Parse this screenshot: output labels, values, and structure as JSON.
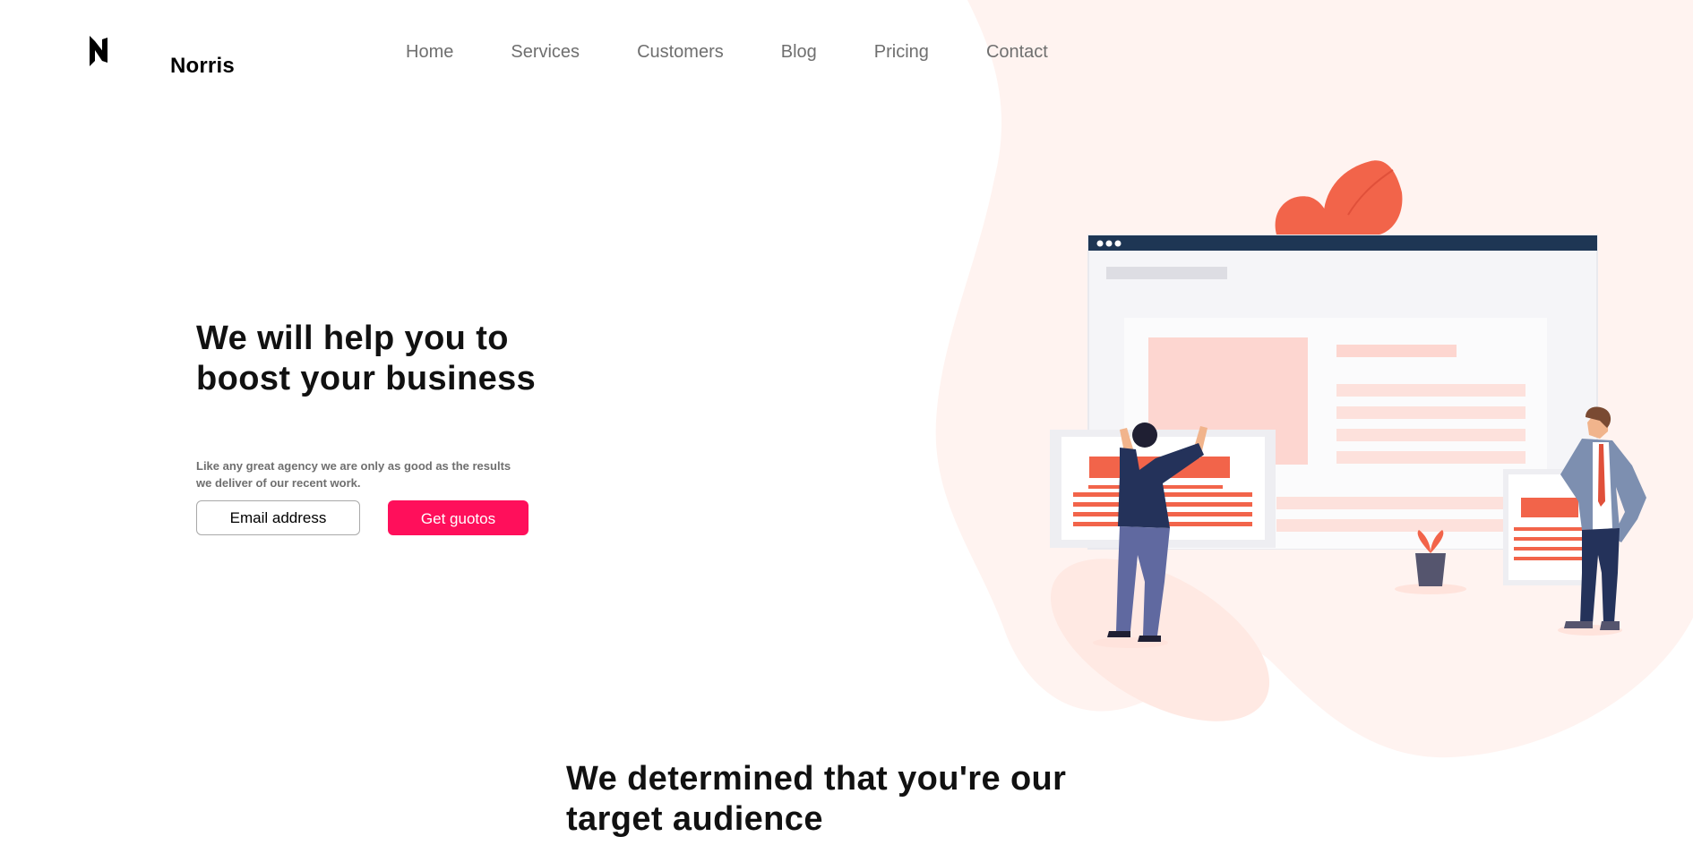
{
  "brand": {
    "name": "Norris",
    "logo_icon": "n-logo-icon"
  },
  "nav": {
    "items": [
      "Home",
      "Services",
      "Customers",
      "Blog",
      "Pricing",
      "Contact"
    ]
  },
  "hero": {
    "title": "We will help you to boost your business",
    "subtitle": "Like any great agency we are only as good as the results we deliver of our recent work.",
    "email_placeholder": "Email address",
    "cta_label": "Get guotos"
  },
  "audience": {
    "title": "We determined that you're our target audience"
  },
  "colors": {
    "accent": "#ff0f5b",
    "illustration_coral": "#f2644a",
    "blob": "#fff3f0",
    "window_bar": "#1e3654"
  }
}
